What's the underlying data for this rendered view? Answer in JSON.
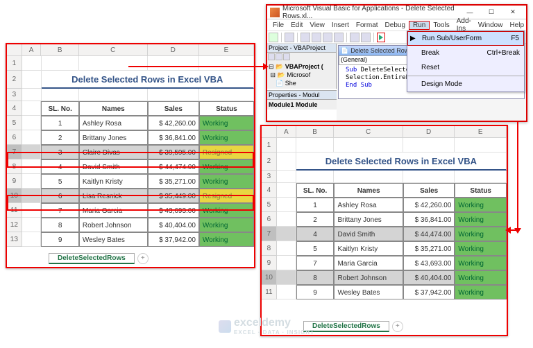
{
  "vba": {
    "title": "Microsoft Visual Basic for Applications - Delete Selected Rows.xl...",
    "menu": {
      "file": "File",
      "edit": "Edit",
      "view": "View",
      "insert": "Insert",
      "format": "Format",
      "debug": "Debug",
      "run": "Run",
      "tools": "Tools",
      "addins": "Add-Ins",
      "window": "Window",
      "help": "Help"
    },
    "run_menu": {
      "run_label": "Run Sub/UserForm",
      "run_sc": "F5",
      "break_label": "Break",
      "break_sc": "Ctrl+Break",
      "reset_label": "Reset",
      "design_label": "Design Mode"
    },
    "project_hdr": "Project - VBAProject",
    "tree": {
      "root": "VBAProject (",
      "obj": "Microsof",
      "sheet": "She"
    },
    "props_hdr": "Properties - Modul",
    "props_item": "Module1 Module",
    "code_title": "Delete Selected Rows",
    "code_dd": "(General)",
    "code": {
      "l1a": "Sub",
      "l1b": " DeleteSelectedRows()",
      "l2": "Selection.EntireRow.Delete",
      "l3": "End Sub"
    }
  },
  "columns_before": {
    "a": 28,
    "b": 55,
    "c": 100,
    "d": 75,
    "e": 80
  },
  "columns_after": {
    "a": 28,
    "b": 55,
    "c": 100,
    "d": 75,
    "e": 75
  },
  "sheet_title": "Delete Selected Rows in Excel VBA",
  "headers": {
    "sl": "SL. No.",
    "names": "Names",
    "sales": "Sales",
    "status": "Status"
  },
  "rows_before": [
    {
      "sl": "1",
      "name": "Ashley Rosa",
      "sales": "$  42,260.00",
      "status": "Working",
      "st": "w",
      "sel": false
    },
    {
      "sl": "2",
      "name": "Brittany Jones",
      "sales": "$  36,841.00",
      "status": "Working",
      "st": "w",
      "sel": false
    },
    {
      "sl": "3",
      "name": "Claire Divas",
      "sales": "$  39,595.00",
      "status": "Resigned",
      "st": "r",
      "sel": true
    },
    {
      "sl": "4",
      "name": "David Smith",
      "sales": "$  44,474.00",
      "status": "Working",
      "st": "w",
      "sel": false
    },
    {
      "sl": "5",
      "name": "Kaitlyn Kristy",
      "sales": "$  35,271.00",
      "status": "Working",
      "st": "w",
      "sel": false
    },
    {
      "sl": "6",
      "name": "Lisa Resnick",
      "sales": "$  35,449.00",
      "status": "Resigned",
      "st": "r",
      "sel": true
    },
    {
      "sl": "7",
      "name": "Maria Garcia",
      "sales": "$  43,693.00",
      "status": "Working",
      "st": "w",
      "sel": false
    },
    {
      "sl": "8",
      "name": "Robert Johnson",
      "sales": "$  40,404.00",
      "status": "Working",
      "st": "w",
      "sel": false
    },
    {
      "sl": "9",
      "name": "Wesley Bates",
      "sales": "$  37,942.00",
      "status": "Working",
      "st": "w",
      "sel": false
    }
  ],
  "rows_after": [
    {
      "sl": "1",
      "name": "Ashley Rosa",
      "sales": "$  42,260.00",
      "status": "Working",
      "st": "w",
      "sel": false
    },
    {
      "sl": "2",
      "name": "Brittany Jones",
      "sales": "$  36,841.00",
      "status": "Working",
      "st": "w",
      "sel": false
    },
    {
      "sl": "4",
      "name": "David Smith",
      "sales": "$  44,474.00",
      "status": "Working",
      "st": "w",
      "sel": true
    },
    {
      "sl": "5",
      "name": "Kaitlyn Kristy",
      "sales": "$  35,271.00",
      "status": "Working",
      "st": "w",
      "sel": false
    },
    {
      "sl": "7",
      "name": "Maria Garcia",
      "sales": "$  43,693.00",
      "status": "Working",
      "st": "w",
      "sel": false
    },
    {
      "sl": "8",
      "name": "Robert Johnson",
      "sales": "$  40,404.00",
      "status": "Working",
      "st": "w",
      "sel": true
    },
    {
      "sl": "9",
      "name": "Wesley Bates",
      "sales": "$  37,942.00",
      "status": "Working",
      "st": "w",
      "sel": false
    }
  ],
  "tab_name": "DeleteSelectedRows",
  "watermark": {
    "name": "exceldemy",
    "sub": "EXCEL · DATA · INSIGHT"
  }
}
